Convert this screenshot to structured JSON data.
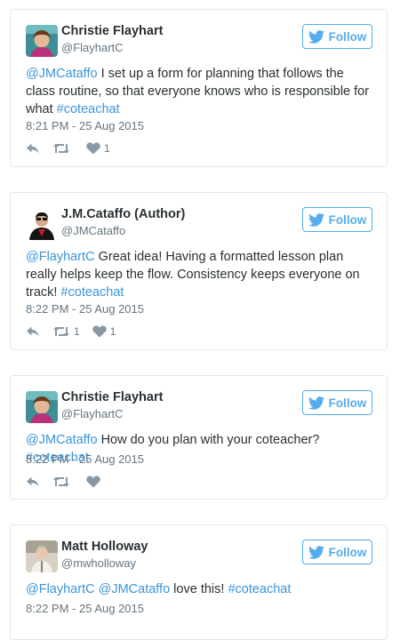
{
  "tweets": [
    {
      "name": "Christie Flayhart",
      "handle": "@FlayhartC",
      "follow_label": "Follow",
      "mention": "@JMCataffo",
      "body": " I set up a form for planning that follows the class routine, so that everyone knows who is responsible for what ",
      "hashtag": "#coteachat",
      "time": "8:21 PM - 25 Aug 2015",
      "retweets": "",
      "likes": "1"
    },
    {
      "name": "J.M.Cataffo (Author)",
      "handle": "@JMCataffo",
      "follow_label": "Follow",
      "mention": "@FlayhartC",
      "body": " Great idea! Having a formatted lesson plan really helps keep the flow. Consistency keeps everyone on track! ",
      "hashtag": "#coteachat",
      "time": "8:22 PM - 25 Aug 2015",
      "retweets": "1",
      "likes": "1"
    },
    {
      "name": "Christie Flayhart",
      "handle": "@FlayhartC",
      "follow_label": "Follow",
      "mention": "@JMCataffo",
      "body": " How do you plan with your coteacher? ",
      "hashtag": "#coteachat",
      "time": "8:22 PM - 25 Aug 2015",
      "retweets": "",
      "likes": ""
    },
    {
      "name": "Matt Holloway",
      "handle": "@mwholloway",
      "follow_label": "Follow",
      "mention": "@FlayhartC",
      "mention2": "@JMCataffo",
      "body": " love this! ",
      "hashtag": "#coteachat",
      "time": "8:22 PM - 25 Aug 2015"
    }
  ],
  "icons": {
    "follow": "twitter-bird-icon",
    "reply": "reply-icon",
    "retweet": "retweet-icon",
    "like": "heart-icon"
  },
  "colors": {
    "link": "#3b94d9",
    "accent": "#55acee",
    "muted": "#66757f",
    "icon": "#8899a6",
    "border": "#e1e8ed"
  }
}
